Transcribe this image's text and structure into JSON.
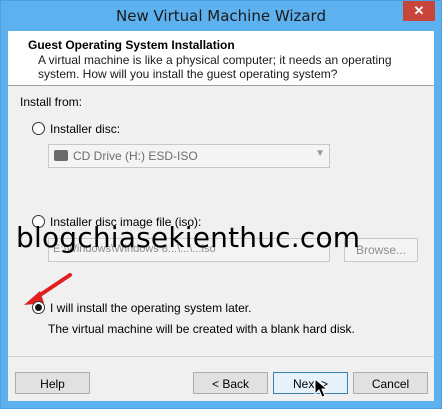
{
  "window": {
    "title": "New Virtual Machine Wizard",
    "close_label": "✕"
  },
  "header": {
    "title": "Guest Operating System Installation",
    "description": "A virtual machine is like a physical computer; it needs an operating system. How will you install the guest operating system?"
  },
  "install_from_label": "Install from:",
  "options": [
    {
      "label": "Installer disc:",
      "selected": false
    },
    {
      "label": "Installer disc image file (iso):",
      "selected": false
    },
    {
      "label": "I will install the operating system later.",
      "selected": true
    }
  ],
  "disc_dropdown": {
    "value": "CD Drive (H:) ESD-ISO"
  },
  "iso_path": {
    "value": "E:\\Windows\\Windows 8...\\...\\...iso"
  },
  "browse_label": "Browse...",
  "later_note": "The virtual machine will be created with a blank hard disk.",
  "watermark": "blogchiasekienthuc.com",
  "buttons": {
    "help": "Help",
    "back": "< Back",
    "next": "Next >",
    "cancel": "Cancel"
  },
  "colors": {
    "titlebar": "#5eb1ef",
    "close": "#c7453a",
    "arrow": "#e02020"
  }
}
